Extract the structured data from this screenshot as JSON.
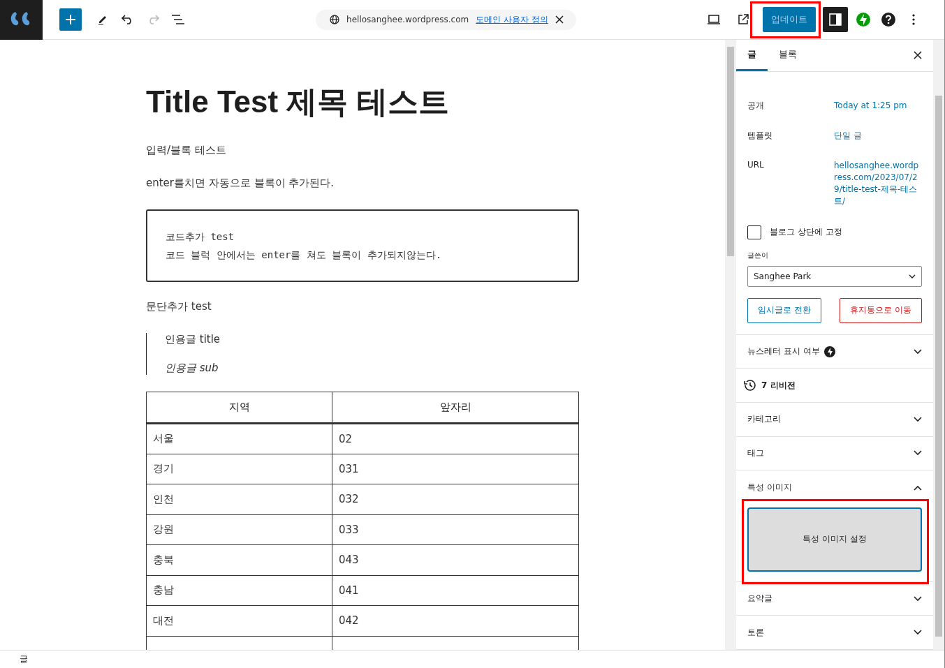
{
  "toolbar": {
    "address": "hellosanghee.wordpress.com",
    "address_link": "도메인 사용자 정의",
    "update_button": "업데이트",
    "settings_open": true
  },
  "editor": {
    "title": "Title Test 제목 테스트",
    "paragraphs": [
      "입력/블록 테스트",
      "enter를치면 자동으로 블록이 추가된다."
    ],
    "code_lines": [
      "코드추가 test",
      "코드 블럭 안에서는 enter를 쳐도 블록이 추가되지않는다."
    ],
    "paragraph_after": "문단추가 test",
    "quote": {
      "text": "인용글 title",
      "citation": "인용글 sub"
    },
    "table": {
      "columns": [
        "지역",
        "앞자리"
      ],
      "rows": [
        [
          "서울",
          "02"
        ],
        [
          "경기",
          "031"
        ],
        [
          "인천",
          "032"
        ],
        [
          "강원",
          "033"
        ],
        [
          "충북",
          "043"
        ],
        [
          "충남",
          "041"
        ],
        [
          "대전",
          "042"
        ]
      ]
    }
  },
  "sidebar": {
    "tabs": [
      {
        "label": "글",
        "selected": true
      },
      {
        "label": "블록",
        "selected": false
      }
    ],
    "fields": [
      {
        "label": "공개",
        "value": "Today at 1:25 pm"
      },
      {
        "label": "템플릿",
        "value": "단일 글"
      },
      {
        "label": "URL",
        "value": "hellosanghee.wordpress.com/2023/07/29/title-test-제목-테스트/"
      }
    ],
    "pin": {
      "label": "블로그 상단에 고정",
      "checked": false
    },
    "author": {
      "label": "글쓴이",
      "value": "Sanghee Park"
    },
    "draft_button": "임시글로 전환",
    "trash_button": "휴지통으로 이동",
    "panels": [
      {
        "kind": "newsletter",
        "title": "뉴스레터 표시 여부",
        "expanded": false
      },
      {
        "kind": "revisions",
        "title": "7 리비전"
      },
      {
        "kind": "panel",
        "title": "카테고리",
        "expanded": false
      },
      {
        "kind": "panel",
        "title": "태그",
        "expanded": false
      },
      {
        "kind": "featured",
        "title": "특성 이미지",
        "expanded": true,
        "button": "특성 이미지 설정"
      },
      {
        "kind": "panel",
        "title": "요약글",
        "expanded": false
      },
      {
        "kind": "panel",
        "title": "토론",
        "expanded": false
      }
    ]
  },
  "status_bar": "글"
}
